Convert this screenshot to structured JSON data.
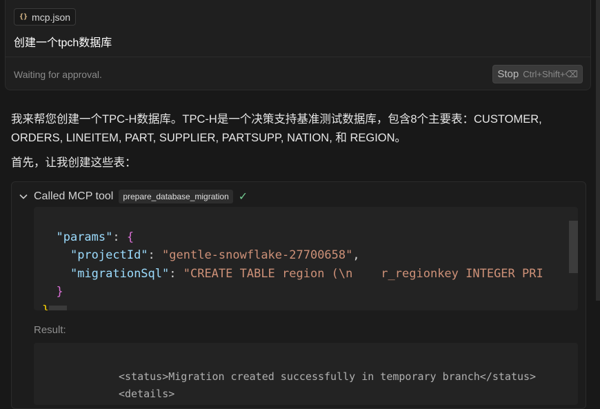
{
  "request": {
    "file_chip": {
      "icon": "braces-icon",
      "label": "mcp.json"
    },
    "prompt": "创建一个tpch数据库",
    "status": "Waiting for approval.",
    "stop_button": {
      "label": "Stop",
      "shortcut": "Ctrl+Shift+⌫"
    }
  },
  "assistant": {
    "paragraph_1": "我来帮您创建一个TPC-H数据库。TPC-H是一个决策支持基准测试数据库，包含8个主要表：CUSTOMER, ORDERS, LINEITEM, PART, SUPPLIER, PARTSUPP, NATION, 和 REGION。",
    "paragraph_2": "首先，让我创建这些表："
  },
  "tool_call": {
    "title": "Called MCP tool",
    "tool_name": "prepare_database_migration",
    "status_icon": "check-icon",
    "code": {
      "params_key": "\"params\"",
      "open_brace": "{",
      "project_key": "\"projectId\"",
      "project_value": "\"gentle-snowflake-27700658\"",
      "migration_key": "\"migrationSql\"",
      "migration_value": "\"CREATE TABLE region (\\n    r_regionkey INTEGER PRI",
      "close_inner": "}",
      "close_outer": "}"
    },
    "result_label": "Result:",
    "result_lines": [
      "<status>Migration created successfully in temporary branch</status>",
      "<details>"
    ]
  }
}
